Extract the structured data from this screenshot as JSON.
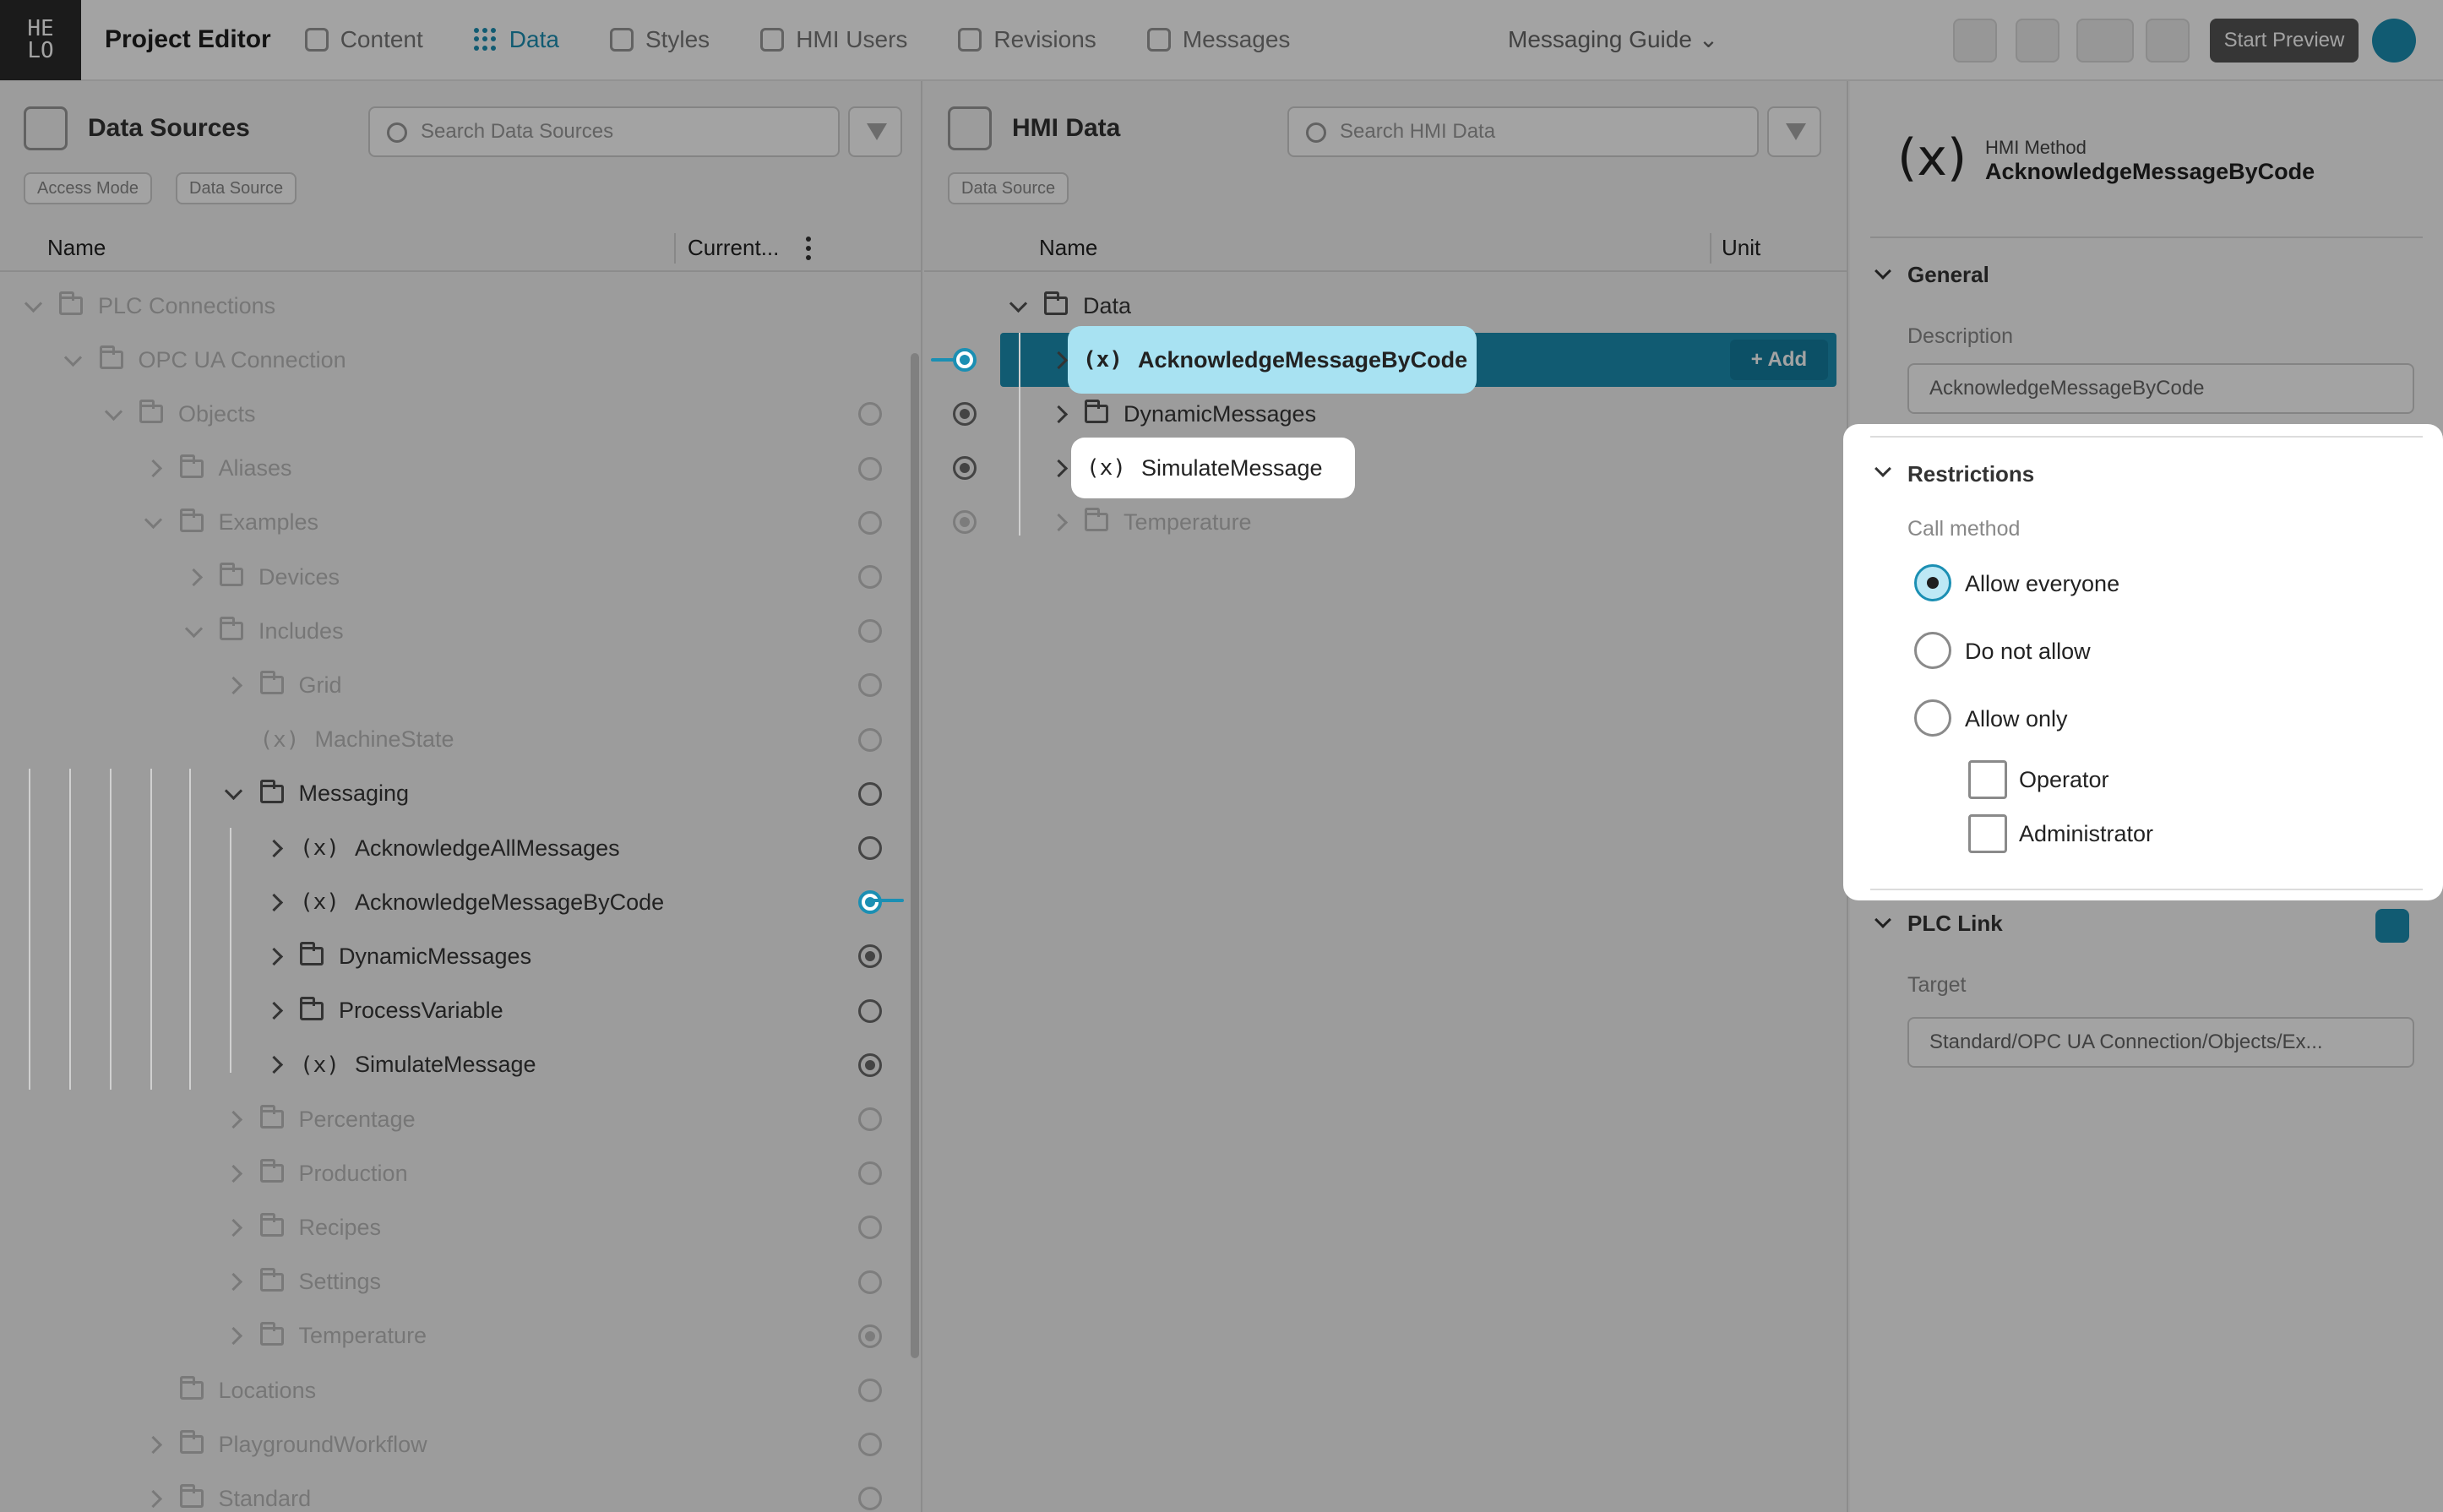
{
  "app": {
    "logo_text": "HE\nLO",
    "title": "Project Editor",
    "nav": [
      {
        "label": "Content",
        "icon": "content-icon"
      },
      {
        "label": "Data",
        "icon": "data-icon"
      },
      {
        "label": "Styles",
        "icon": "styles-icon"
      },
      {
        "label": "HMI Users",
        "icon": "users-icon"
      },
      {
        "label": "Revisions",
        "icon": "revisions-icon"
      },
      {
        "label": "Messages",
        "icon": "messages-icon"
      }
    ],
    "project_selector": "Messaging Guide",
    "primary_action": "Start Preview"
  },
  "left_panel": {
    "title": "Data Sources",
    "search_placeholder": "Search Data Sources",
    "chips": [
      "Access Mode",
      "Data Source"
    ],
    "columns": {
      "name": "Name",
      "current": "Current..."
    },
    "tree": [
      {
        "label": "PLC Connections",
        "indent": 0,
        "icon": "folder",
        "chev": "down",
        "dim": true,
        "status": "none"
      },
      {
        "label": "OPC UA Connection",
        "indent": 1,
        "icon": "folder",
        "chev": "down",
        "dim": true,
        "status": "none"
      },
      {
        "label": "Objects",
        "indent": 2,
        "icon": "folder",
        "chev": "down",
        "dim": true,
        "status": "empty"
      },
      {
        "label": "Aliases",
        "indent": 3,
        "icon": "folder",
        "chev": "right",
        "dim": true,
        "status": "empty"
      },
      {
        "label": "Examples",
        "indent": 3,
        "icon": "folder",
        "chev": "down",
        "dim": true,
        "status": "empty"
      },
      {
        "label": "Devices",
        "indent": 4,
        "icon": "folder",
        "chev": "right",
        "dim": true,
        "status": "empty"
      },
      {
        "label": "Includes",
        "indent": 4,
        "icon": "folder",
        "chev": "down",
        "dim": true,
        "status": "empty"
      },
      {
        "label": "Grid",
        "indent": 5,
        "icon": "folder",
        "chev": "right",
        "dim": true,
        "status": "empty"
      },
      {
        "label": "MachineState",
        "indent": 5,
        "icon": "method",
        "chev": "none",
        "dim": true,
        "status": "empty"
      },
      {
        "label": "Messaging",
        "indent": 5,
        "icon": "folder",
        "chev": "down",
        "dim": false,
        "status": "empty"
      },
      {
        "label": "AcknowledgeAllMessages",
        "indent": 6,
        "icon": "method",
        "chev": "right",
        "dim": false,
        "status": "empty"
      },
      {
        "label": "AcknowledgeMessageByCode",
        "indent": 6,
        "icon": "method",
        "chev": "right",
        "dim": false,
        "status": "linked"
      },
      {
        "label": "DynamicMessages",
        "indent": 6,
        "icon": "folder",
        "chev": "right",
        "dim": false,
        "status": "filled"
      },
      {
        "label": "ProcessVariable",
        "indent": 6,
        "icon": "folder",
        "chev": "right",
        "dim": false,
        "status": "empty"
      },
      {
        "label": "SimulateMessage",
        "indent": 6,
        "icon": "method",
        "chev": "right",
        "dim": false,
        "status": "filled"
      },
      {
        "label": "Percentage",
        "indent": 5,
        "icon": "folder",
        "chev": "right",
        "dim": true,
        "status": "empty"
      },
      {
        "label": "Production",
        "indent": 5,
        "icon": "folder",
        "chev": "right",
        "dim": true,
        "status": "empty"
      },
      {
        "label": "Recipes",
        "indent": 5,
        "icon": "folder",
        "chev": "right",
        "dim": true,
        "status": "empty"
      },
      {
        "label": "Settings",
        "indent": 5,
        "icon": "folder",
        "chev": "right",
        "dim": true,
        "status": "empty"
      },
      {
        "label": "Temperature",
        "indent": 5,
        "icon": "folder",
        "chev": "right",
        "dim": true,
        "status": "filled"
      },
      {
        "label": "Locations",
        "indent": 3,
        "icon": "folder",
        "chev": "none",
        "dim": true,
        "status": "empty"
      },
      {
        "label": "PlaygroundWorkflow",
        "indent": 3,
        "icon": "folder",
        "chev": "right",
        "dim": true,
        "status": "empty"
      },
      {
        "label": "Standard",
        "indent": 3,
        "icon": "folder",
        "chev": "right",
        "dim": true,
        "status": "empty"
      }
    ]
  },
  "mid_panel": {
    "title": "HMI Data",
    "search_placeholder": "Search HMI Data",
    "chips": [
      "Data Source"
    ],
    "columns": {
      "name": "Name",
      "unit": "Unit"
    },
    "tree": [
      {
        "label": "Data",
        "icon": "folder",
        "chev": "down",
        "level": 0,
        "dim": false,
        "status": "none"
      },
      {
        "label": "AcknowledgeMessageByCode",
        "icon": "method",
        "chev": "right",
        "level": 1,
        "dim": false,
        "status": "linked",
        "selected": true
      },
      {
        "label": "DynamicMessages",
        "icon": "folder",
        "chev": "right",
        "level": 1,
        "dim": false,
        "status": "filled"
      },
      {
        "label": "SimulateMessage",
        "icon": "method",
        "chev": "right",
        "level": 1,
        "dim": false,
        "status": "filled"
      },
      {
        "label": "Temperature",
        "icon": "folder",
        "chev": "right",
        "level": 1,
        "dim": true,
        "status": "filled"
      }
    ],
    "add_label": "+ Add"
  },
  "right_panel": {
    "icon_glyph": "(x)",
    "type": "HMI Method",
    "name": "AcknowledgeMessageByCode",
    "general": {
      "title": "General",
      "description_label": "Description",
      "description_value": "AcknowledgeMessageByCode"
    },
    "restrictions": {
      "title": "Restrictions",
      "call_method_label": "Call method",
      "options": [
        {
          "label": "Allow everyone",
          "checked": true
        },
        {
          "label": "Do not allow",
          "checked": false
        },
        {
          "label": "Allow only",
          "checked": false
        }
      ],
      "roles": [
        {
          "label": "Operator",
          "checked": false
        },
        {
          "label": "Administrator",
          "checked": false
        }
      ]
    },
    "plc_link": {
      "title": "PLC Link",
      "target_label": "Target",
      "target_value": "Standard/OPC UA Connection/Objects/Ex..."
    }
  }
}
